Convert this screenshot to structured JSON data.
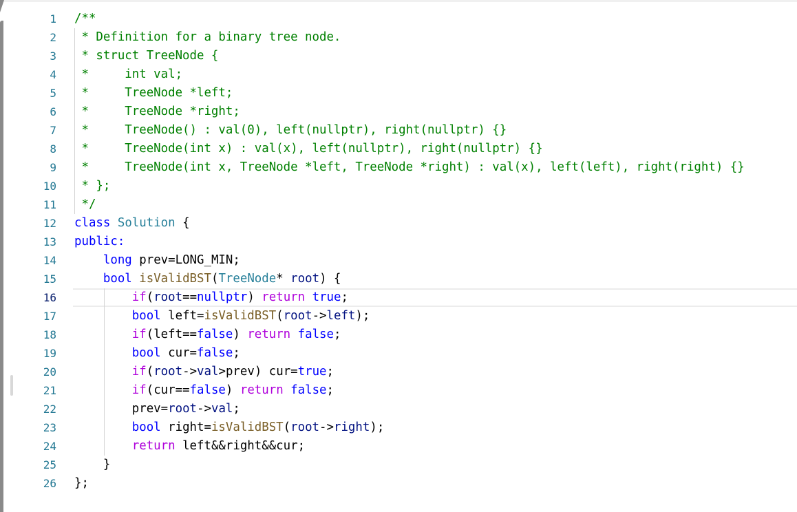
{
  "editor": {
    "line_numbers": [
      "1",
      "2",
      "3",
      "4",
      "5",
      "6",
      "7",
      "8",
      "9",
      "10",
      "11",
      "12",
      "13",
      "14",
      "15",
      "16",
      "17",
      "18",
      "19",
      "20",
      "21",
      "22",
      "23",
      "24",
      "25",
      "26"
    ],
    "current_line": 16,
    "lines": [
      [
        {
          "t": "/**",
          "c": "c"
        }
      ],
      [
        {
          "t": " * Definition for a binary tree node.",
          "c": "c"
        }
      ],
      [
        {
          "t": " * struct TreeNode {",
          "c": "c"
        }
      ],
      [
        {
          "t": " *     int val;",
          "c": "c"
        }
      ],
      [
        {
          "t": " *     TreeNode *left;",
          "c": "c"
        }
      ],
      [
        {
          "t": " *     TreeNode *right;",
          "c": "c"
        }
      ],
      [
        {
          "t": " *     TreeNode() : val(0), left(nullptr), right(nullptr) {}",
          "c": "c"
        }
      ],
      [
        {
          "t": " *     TreeNode(int x) : val(x), left(nullptr), right(nullptr) {}",
          "c": "c"
        }
      ],
      [
        {
          "t": " *     TreeNode(int x, TreeNode *left, TreeNode *right) : val(x), left(left), right(right) {}",
          "c": "c"
        }
      ],
      [
        {
          "t": " * };",
          "c": "c"
        }
      ],
      [
        {
          "t": " */",
          "c": "c"
        }
      ],
      [
        {
          "t": "class",
          "c": "k"
        },
        {
          "t": " "
        },
        {
          "t": "Solution",
          "c": "t"
        },
        {
          "t": " {"
        }
      ],
      [
        {
          "t": "public:",
          "c": "k"
        }
      ],
      [
        {
          "t": "    "
        },
        {
          "t": "long",
          "c": "k"
        },
        {
          "t": " prev=LONG_MIN;"
        }
      ],
      [
        {
          "t": "    "
        },
        {
          "t": "bool",
          "c": "k"
        },
        {
          "t": " "
        },
        {
          "t": "isValidBST",
          "c": "f"
        },
        {
          "t": "("
        },
        {
          "t": "TreeNode",
          "c": "t"
        },
        {
          "t": "* "
        },
        {
          "t": "root",
          "c": "v"
        },
        {
          "t": ") {"
        }
      ],
      [
        {
          "t": "        "
        },
        {
          "t": "if",
          "c": "p"
        },
        {
          "t": "("
        },
        {
          "t": "root",
          "c": "v"
        },
        {
          "t": "=="
        },
        {
          "t": "nullptr",
          "c": "k"
        },
        {
          "t": ") "
        },
        {
          "t": "return",
          "c": "p"
        },
        {
          "t": " "
        },
        {
          "t": "true",
          "c": "k"
        },
        {
          "t": ";"
        }
      ],
      [
        {
          "t": "        "
        },
        {
          "t": "bool",
          "c": "k"
        },
        {
          "t": " left="
        },
        {
          "t": "isValidBST",
          "c": "f"
        },
        {
          "t": "("
        },
        {
          "t": "root",
          "c": "v"
        },
        {
          "t": "->"
        },
        {
          "t": "left",
          "c": "v"
        },
        {
          "t": ");"
        }
      ],
      [
        {
          "t": "        "
        },
        {
          "t": "if",
          "c": "p"
        },
        {
          "t": "(left=="
        },
        {
          "t": "false",
          "c": "k"
        },
        {
          "t": ") "
        },
        {
          "t": "return",
          "c": "p"
        },
        {
          "t": " "
        },
        {
          "t": "false",
          "c": "k"
        },
        {
          "t": ";"
        }
      ],
      [
        {
          "t": "        "
        },
        {
          "t": "bool",
          "c": "k"
        },
        {
          "t": " cur="
        },
        {
          "t": "false",
          "c": "k"
        },
        {
          "t": ";"
        }
      ],
      [
        {
          "t": "        "
        },
        {
          "t": "if",
          "c": "p"
        },
        {
          "t": "("
        },
        {
          "t": "root",
          "c": "v"
        },
        {
          "t": "->"
        },
        {
          "t": "val",
          "c": "v"
        },
        {
          "t": ">prev) cur="
        },
        {
          "t": "true",
          "c": "k"
        },
        {
          "t": ";"
        }
      ],
      [
        {
          "t": "        "
        },
        {
          "t": "if",
          "c": "p"
        },
        {
          "t": "(cur=="
        },
        {
          "t": "false",
          "c": "k"
        },
        {
          "t": ") "
        },
        {
          "t": "return",
          "c": "p"
        },
        {
          "t": " "
        },
        {
          "t": "false",
          "c": "k"
        },
        {
          "t": ";"
        }
      ],
      [
        {
          "t": "        prev="
        },
        {
          "t": "root",
          "c": "v"
        },
        {
          "t": "->"
        },
        {
          "t": "val",
          "c": "v"
        },
        {
          "t": ";"
        }
      ],
      [
        {
          "t": "        "
        },
        {
          "t": "bool",
          "c": "k"
        },
        {
          "t": " right="
        },
        {
          "t": "isValidBST",
          "c": "f"
        },
        {
          "t": "("
        },
        {
          "t": "root",
          "c": "v"
        },
        {
          "t": "->"
        },
        {
          "t": "right",
          "c": "v"
        },
        {
          "t": ");"
        }
      ],
      [
        {
          "t": "        "
        },
        {
          "t": "return",
          "c": "p"
        },
        {
          "t": " left&&right&&cur;"
        }
      ],
      [
        {
          "t": "    }"
        }
      ],
      [
        {
          "t": "};"
        }
      ]
    ]
  },
  "colors": {
    "comment": "#008000",
    "keyword": "#0000ff",
    "control": "#af00db",
    "type": "#267f99",
    "function": "#795e26",
    "variable": "#001080",
    "line_number": "#237893"
  }
}
